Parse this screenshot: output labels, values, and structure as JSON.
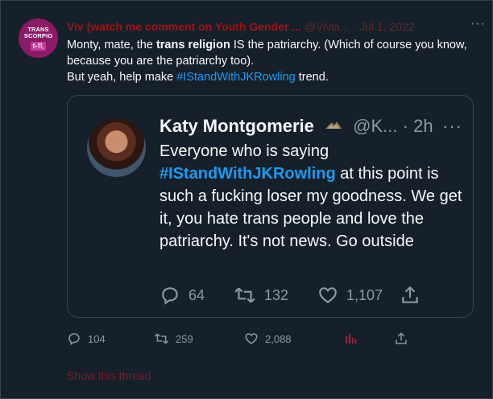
{
  "tweet": {
    "avatar": {
      "line1": "TRANS",
      "line2": "SCORPIO",
      "badge": "t-♏"
    },
    "display_name": "Viv (watch me comment on Youth Gender ...",
    "handle": "@Vivia...",
    "separator": "·",
    "time": "Jul 1, 2022",
    "more": "···",
    "text_part1": "Monty, mate, the ",
    "text_bold": "trans religion",
    "text_part2": " IS the patriarchy. (Which of course you know, because you are the patriarchy too).",
    "text_line2_part1": "But yeah, help make ",
    "text_hashtag": "#IStandWithJKRowling",
    "text_line2_part2": " trend.",
    "replies": "104",
    "retweets": "259",
    "likes": "2,088",
    "show_thread": "Show this thread"
  },
  "quoted": {
    "display_name": "Katy Montgomerie",
    "handle": "@K...",
    "separator": "·",
    "time": "2h",
    "more": "···",
    "text_part1": "Everyone who is saying ",
    "text_hashtag": "#IStandWithJKRowling",
    "text_part2": " at this point is such a fucking loser my goodness. We get it, you hate trans people and love the patriarchy. It's not news. Go outside",
    "replies": "64",
    "retweets": "132",
    "likes": "1,107"
  },
  "colors": {
    "background": "#15202b",
    "border": "#38444d",
    "text": "#f7f9f9",
    "muted": "#8b98a5",
    "link": "#1d9bf0",
    "analytics": "#b01e3a"
  },
  "icons": [
    "reply-icon",
    "retweet-icon",
    "like-icon",
    "share-icon",
    "analytics-icon",
    "more-icon",
    "trans-flag-emoji-icon"
  ]
}
